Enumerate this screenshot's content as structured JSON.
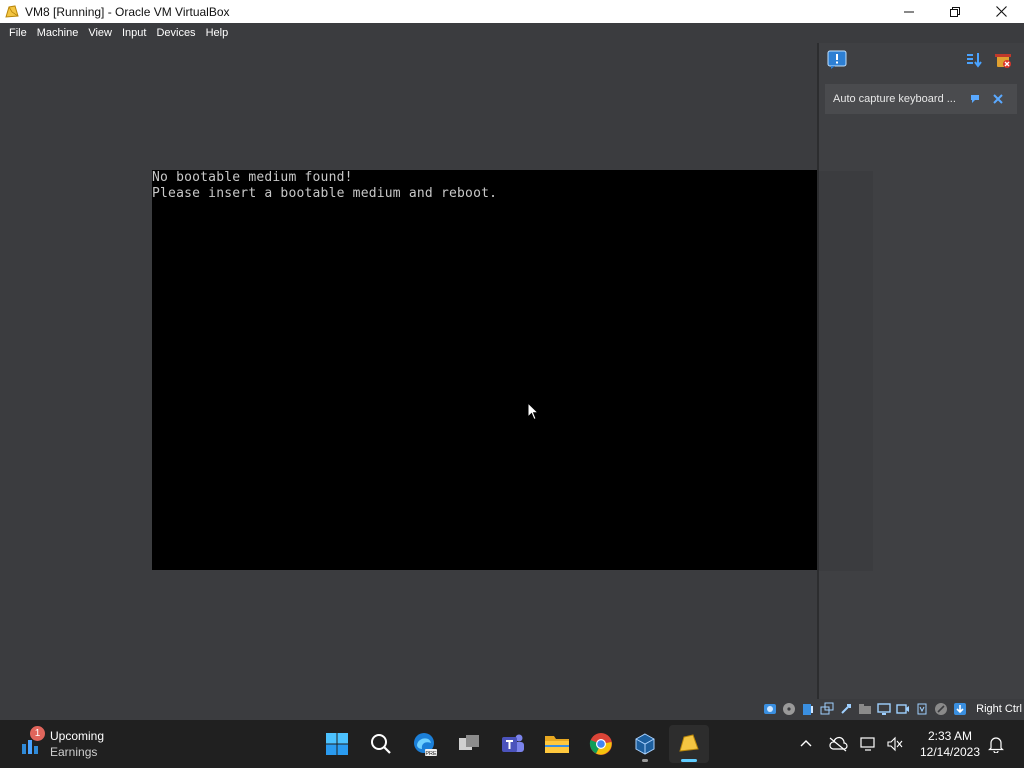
{
  "window": {
    "title": "VM8 [Running] - Oracle VM VirtualBox"
  },
  "menu": [
    "File",
    "Machine",
    "View",
    "Input",
    "Devices",
    "Help"
  ],
  "vm": {
    "lines": [
      "No bootable medium found!",
      "Please insert a bootable medium and reboot."
    ]
  },
  "side_panel": {
    "notification_text": "Auto capture keyboard ..."
  },
  "statusbar": {
    "host_key": "Right Ctrl",
    "icons": [
      "hard-disk-icon",
      "optical-disk-icon",
      "audio-icon",
      "network-icon",
      "usb-icon",
      "shared-folders-icon",
      "display-icon",
      "recording-icon",
      "cpu-icon",
      "mouse-integration-icon",
      "keyboard-capture-icon"
    ]
  },
  "taskbar": {
    "widget": {
      "badge": "1",
      "title": "Upcoming",
      "subtitle": "Earnings"
    },
    "apps": [
      "start-icon",
      "search-icon",
      "edge-beta-icon",
      "task-view-icon",
      "teams-icon",
      "file-explorer-icon",
      "chrome-icon",
      "virtualbox-icon",
      "virtualbox-vm-icon"
    ],
    "clock": {
      "time": "2:33 AM",
      "date": "12/14/2023"
    }
  },
  "colors": {
    "vm_background": "#000000",
    "frame_background": "#3b3c3f",
    "vm_text": "#c8c8c8",
    "taskbar": "#202020",
    "accent": "#60cdff"
  }
}
